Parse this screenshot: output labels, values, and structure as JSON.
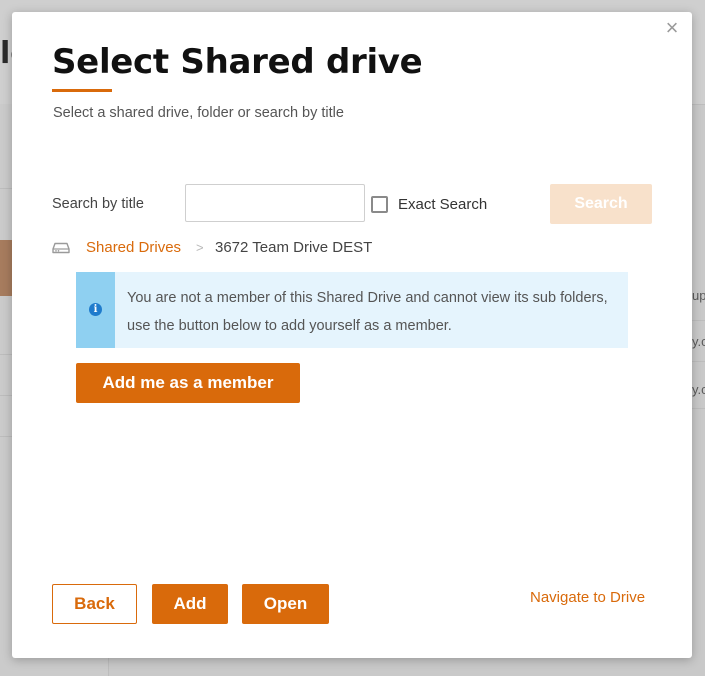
{
  "background": {
    "title_fragment": "le",
    "right_texts": [
      "up",
      "y.c",
      "y.c"
    ]
  },
  "dialog": {
    "close_glyph": "×",
    "title": "Select Shared drive",
    "subtitle": "Select a shared drive, folder or search by title",
    "search": {
      "label": "Search by title",
      "value": "",
      "placeholder": "",
      "exact_label": "Exact Search",
      "exact_checked": false,
      "button_label": "Search"
    },
    "breadcrumb": {
      "root_label": "Shared Drives",
      "separator": ">",
      "current": "3672 Team Drive DEST"
    },
    "alert": {
      "icon_glyph": "i",
      "message": "You are not a member of this Shared Drive and cannot view its sub folders, use the button below to add yourself as a member."
    },
    "add_member_label": "Add me as a member",
    "footer": {
      "back_label": "Back",
      "add_label": "Add",
      "open_label": "Open",
      "navigate_label": "Navigate to Drive"
    }
  },
  "colors": {
    "accent": "#d96a0b",
    "accent_disabled": "#f8e1cb",
    "info_bg": "#e5f4fd",
    "info_bar": "#8fd0f1",
    "info_icon": "#1f7bcc"
  }
}
